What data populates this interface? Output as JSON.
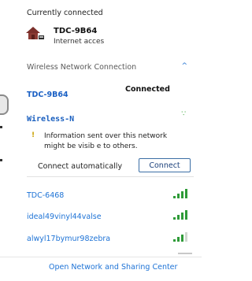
{
  "current": {
    "section_title": "Currently connected",
    "network_name": "TDC-9B64",
    "network_status": "Internet acces",
    "icon": "network-house-icon"
  },
  "group": {
    "title": "Wireless Network Connection",
    "chevron": "^"
  },
  "connected_network": {
    "name": "TDC-9B64",
    "status": "Connected"
  },
  "selected_network": {
    "name": "Wireless-N",
    "signal_glyph": "∵",
    "warning_icon": "!",
    "warning_text": "Information sent over this network might be visib e to others.",
    "auto_connect_label": "Connect automatically",
    "connect_button": "Connect"
  },
  "networks": [
    {
      "name": "TDC-6468",
      "signal": "signal-bars-icon"
    },
    {
      "name": "ideal49vinyl44valse",
      "signal": "signal-bars-icon"
    },
    {
      "name": "alwyl17bymur98zebra",
      "signal": "signal-bars-icon"
    }
  ],
  "footer": {
    "link": "Open Network and Sharing Center"
  },
  "colors": {
    "link": "#1e73d6",
    "signal": "#2e9b38",
    "button_border": "#3b6ea5"
  }
}
